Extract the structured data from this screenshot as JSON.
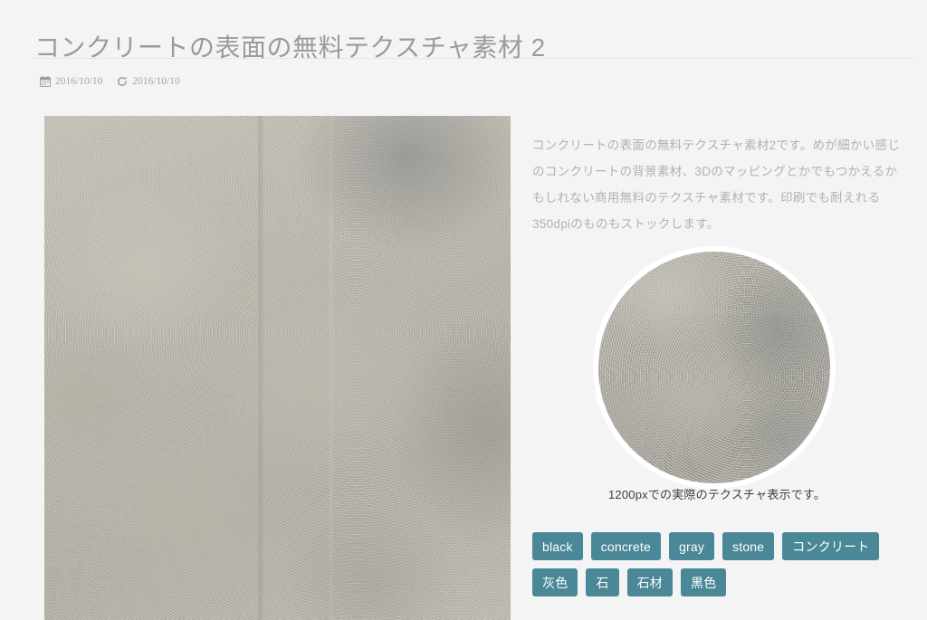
{
  "post": {
    "title": "コンクリートの表面の無料テクスチャ素材 2",
    "meta": {
      "published_icon": "calendar-icon",
      "published_date": "2016/10/10",
      "updated_icon": "refresh-icon",
      "updated_date": "2016/10/10"
    },
    "description": "コンクリートの表面の無料テクスチャ素材2です。めが細かい感じのコンクリートの背景素材、3Dのマッピングとかでもつかえるかもしれない商用無料のテクスチャ素材です。印刷でも耐えれる350dpiのものもストックします。",
    "preview_caption": "1200pxでの実際のテクスチャ表示です。",
    "main_image_alt": "コンクリートの表面のテクスチャ",
    "circle_image_alt": "1200pxテクスチャプレビュー"
  },
  "tags": [
    {
      "label": "black"
    },
    {
      "label": "concrete"
    },
    {
      "label": "gray"
    },
    {
      "label": "stone"
    },
    {
      "label": "コンクリート"
    },
    {
      "label": "灰色"
    },
    {
      "label": "石"
    },
    {
      "label": "石材"
    },
    {
      "label": "黒色"
    }
  ],
  "colors": {
    "background": "#f4f4f4",
    "title_text": "#9b9b9b",
    "body_text": "#b2b2b2",
    "caption_text": "#3e3e3e",
    "meta_text": "#a6a6a6",
    "tag_background": "#4a8897",
    "tag_text": "#ffffff",
    "rule": "#d8d8d8"
  }
}
